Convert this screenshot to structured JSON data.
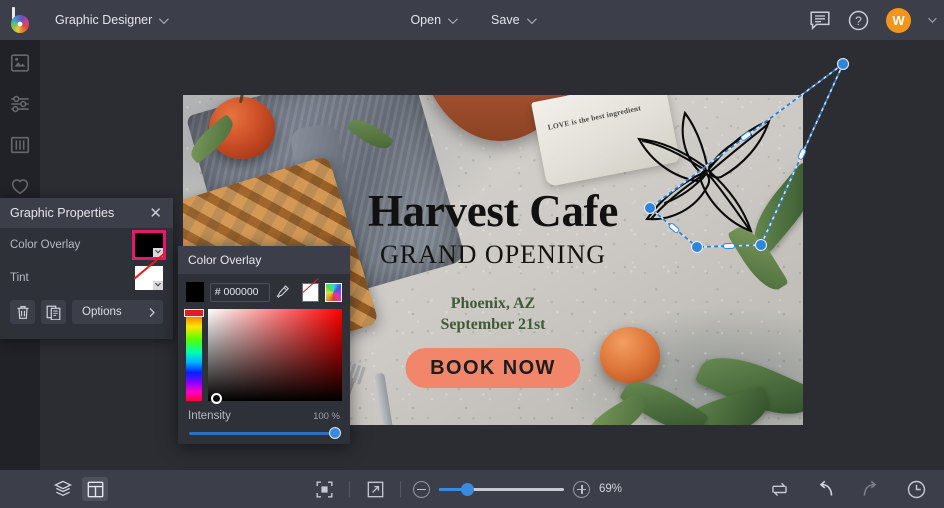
{
  "app": {
    "logo_icon": "brand-color-wheel-logo",
    "project_name": "Graphic Designer"
  },
  "topbar": {
    "open_label": "Open",
    "save_label": "Save",
    "comment_icon": "comment-bubble-icon",
    "help_icon": "help-circle-icon",
    "avatar_initial": "W",
    "avatar_color": "#f3941d"
  },
  "left_rail": {
    "items": [
      {
        "icon": "image-icon",
        "name": "image-tool"
      },
      {
        "icon": "sliders-adjust-icon",
        "name": "adjustments-tool"
      },
      {
        "icon": "columns-icon",
        "name": "effects-tool"
      },
      {
        "icon": "heart-icon",
        "name": "favorites-tool"
      },
      {
        "icon": "triangle-shape-icon",
        "name": "shapes-tool"
      }
    ]
  },
  "properties_panel": {
    "title": "Graphic Properties",
    "close_icon": "close-icon",
    "rows": [
      {
        "label": "Color Overlay",
        "swatch": "#000000",
        "selected": true
      },
      {
        "label": "Tint",
        "swatch": "none",
        "selected": false
      }
    ],
    "delete_icon": "trash-icon",
    "duplicate_icon": "duplicate-icon",
    "options_label": "Options",
    "options_chevron": "chevron-right-icon",
    "selection_accent": "#e8176b"
  },
  "color_popup": {
    "title": "Color Overlay",
    "swatch": "#000000",
    "hex_value": "# 000000",
    "hex_placeholder": "# 000000",
    "eyedropper_icon": "eyedropper-icon",
    "no_color_icon": "no-color-icon",
    "rainbow_icon": "color-spectrum-icon",
    "hue_selected": "#ff0000",
    "intensity_label": "Intensity",
    "intensity_value": "100 %",
    "intensity_percent": 100
  },
  "canvas": {
    "artboard": {
      "title": "Harvest Cafe",
      "subtitle": "GRAND OPENING",
      "location": "Phoenix, AZ",
      "date": "September 21st",
      "cta_label": "BOOK NOW",
      "cta_color": "#f2866a",
      "napkin_text": "LOVE is the best ingredient",
      "title_color": "#111111",
      "location_color": "#3f5a36"
    },
    "selection": {
      "object": "botanical-leaf-line-art",
      "rotated": true,
      "handle_color": "#2f86d8"
    }
  },
  "bottom_bar": {
    "layers_icon": "layers-icon",
    "layout_icon": "layout-panel-icon",
    "fit_icon": "fit-to-screen-icon",
    "fullscreen_icon": "expand-arrow-icon",
    "zoom_out_icon": "zoom-out-icon",
    "zoom_in_icon": "zoom-in-icon",
    "zoom_value": "69%",
    "zoom_percent": 69,
    "swap_icon": "swap-arrows-icon",
    "undo_icon": "undo-icon",
    "redo_icon": "redo-icon",
    "history_icon": "history-clock-icon"
  }
}
